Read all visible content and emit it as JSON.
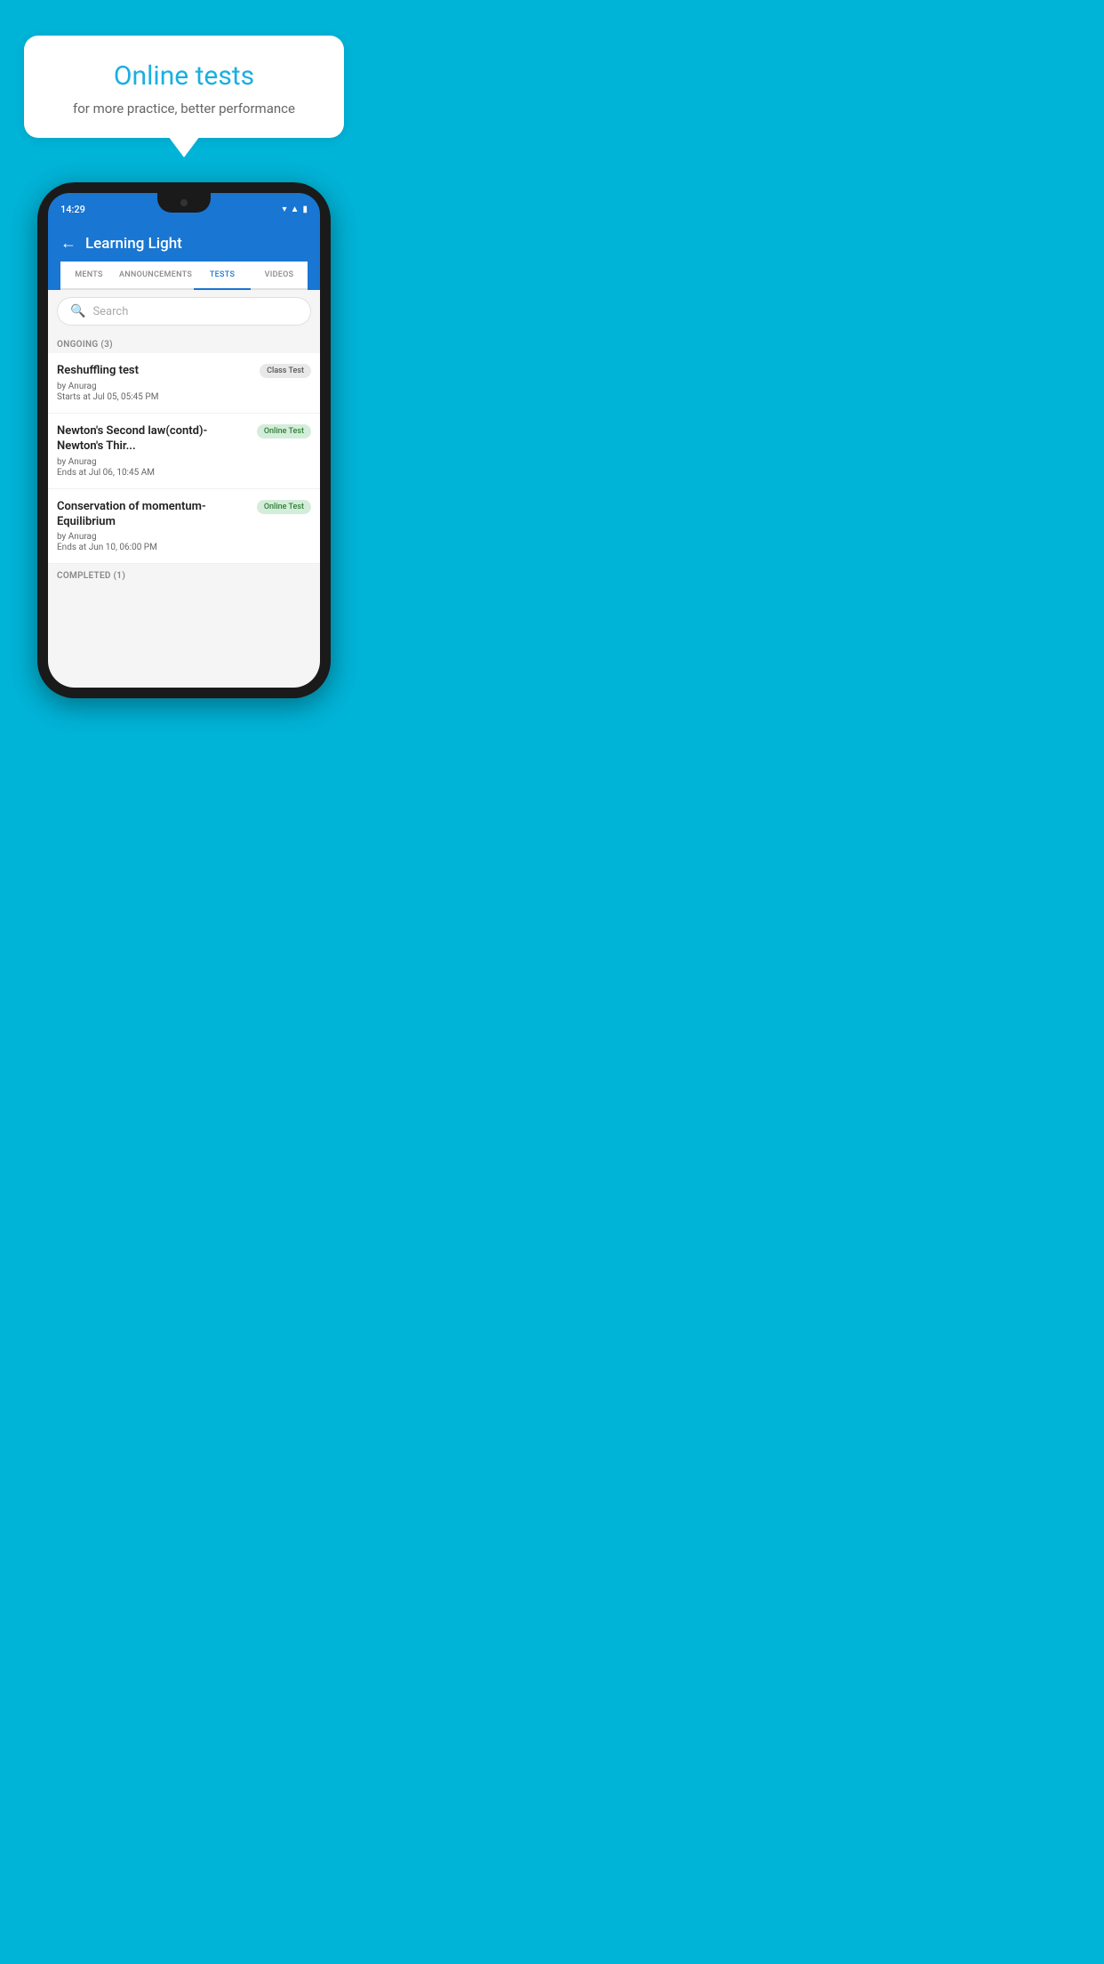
{
  "promo": {
    "title": "Online tests",
    "subtitle": "for more practice, better performance"
  },
  "status_bar": {
    "time": "14:29"
  },
  "header": {
    "back_label": "←",
    "app_title": "Learning Light"
  },
  "tabs": [
    {
      "id": "ments",
      "label": "MENTS",
      "active": false
    },
    {
      "id": "announcements",
      "label": "ANNOUNCEMENTS",
      "active": false
    },
    {
      "id": "tests",
      "label": "TESTS",
      "active": true
    },
    {
      "id": "videos",
      "label": "VIDEOS",
      "active": false
    }
  ],
  "search": {
    "placeholder": "Search"
  },
  "ongoing_section": {
    "label": "ONGOING (3)"
  },
  "tests": [
    {
      "id": "test-1",
      "name": "Reshuffling test",
      "badge": "Class Test",
      "badge_type": "class",
      "by": "by Anurag",
      "time_label": "Starts at",
      "time": "Jul 05, 05:45 PM"
    },
    {
      "id": "test-2",
      "name": "Newton's Second law(contd)-Newton's Thir...",
      "badge": "Online Test",
      "badge_type": "online",
      "by": "by Anurag",
      "time_label": "Ends at",
      "time": "Jul 06, 10:45 AM"
    },
    {
      "id": "test-3",
      "name": "Conservation of momentum-Equilibrium",
      "badge": "Online Test",
      "badge_type": "online",
      "by": "by Anurag",
      "time_label": "Ends at",
      "time": "Jun 10, 06:00 PM"
    }
  ],
  "completed_section": {
    "label": "COMPLETED (1)"
  }
}
